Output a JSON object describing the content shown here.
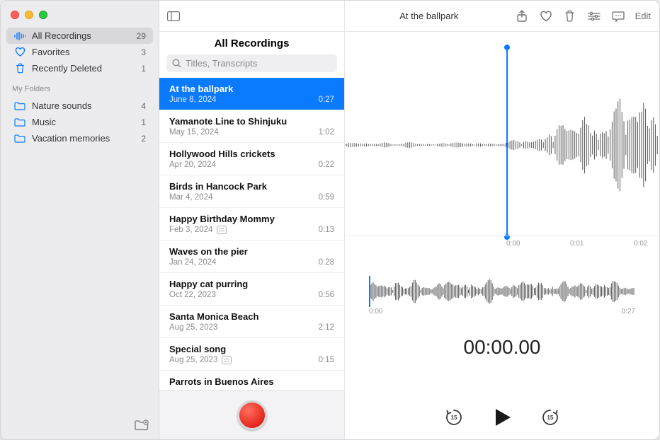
{
  "window": {
    "title": "At the ballpark",
    "editLabel": "Edit"
  },
  "sidebar": {
    "smart": [
      {
        "icon": "waveform",
        "label": "All Recordings",
        "count": "29",
        "selected": true
      },
      {
        "icon": "heart",
        "label": "Favorites",
        "count": "3",
        "selected": false
      },
      {
        "icon": "trash",
        "label": "Recently Deleted",
        "count": "1",
        "selected": false
      }
    ],
    "foldersHeader": "My Folders",
    "folders": [
      {
        "label": "Nature sounds",
        "count": "4"
      },
      {
        "label": "Music",
        "count": "1"
      },
      {
        "label": "Vacation memories",
        "count": "2"
      }
    ]
  },
  "middle": {
    "title": "All Recordings",
    "searchPlaceholder": "Titles, Transcripts",
    "items": [
      {
        "title": "At the ballpark",
        "date": "June 8, 2024",
        "duration": "0:27",
        "selected": true,
        "transcript": false
      },
      {
        "title": "Yamanote Line to Shinjuku",
        "date": "May 15, 2024",
        "duration": "1:02",
        "transcript": false
      },
      {
        "title": "Hollywood Hills crickets",
        "date": "Apr 20, 2024",
        "duration": "0:22",
        "transcript": false
      },
      {
        "title": "Birds in Hancock Park",
        "date": "Mar 4, 2024",
        "duration": "0:59",
        "transcript": false
      },
      {
        "title": "Happy Birthday Mommy",
        "date": "Feb 3, 2024",
        "duration": "0:13",
        "transcript": true
      },
      {
        "title": "Waves on the pier",
        "date": "Jan 24, 2024",
        "duration": "0:28",
        "transcript": false
      },
      {
        "title": "Happy cat purring",
        "date": "Oct 22, 2023",
        "duration": "0:56",
        "transcript": false
      },
      {
        "title": "Santa Monica Beach",
        "date": "Aug 25, 2023",
        "duration": "2:12",
        "transcript": false
      },
      {
        "title": "Special song",
        "date": "Aug 25, 2023",
        "duration": "0:15",
        "transcript": true
      },
      {
        "title": "Parrots in Buenos Aires",
        "date": "",
        "duration": "",
        "transcript": false
      }
    ]
  },
  "detail": {
    "timelineTicks": [
      "0:00",
      "0:01",
      "0:02"
    ],
    "miniStart": "0:00",
    "miniEnd": "0:27",
    "currentTime": "00:00.00",
    "skipSeconds": "15"
  }
}
